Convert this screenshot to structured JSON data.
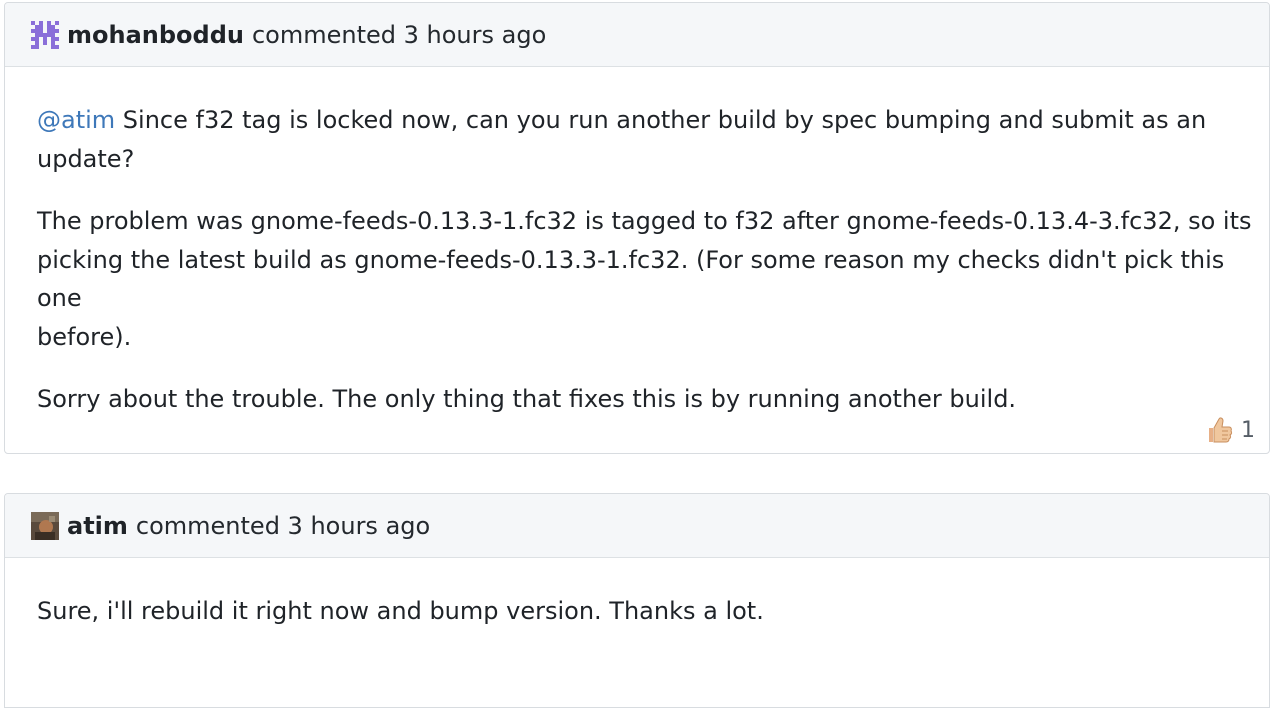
{
  "comments": [
    {
      "author": "mohanboddu",
      "meta": "commented 3 hours ago",
      "mention": "@atim",
      "paragraphs": [
        " Since f32 tag is locked now, can you run another build by spec bumping and submit as an\nupdate?",
        "The problem was gnome-feeds-0.13.3-1.fc32 is tagged to f32 after gnome-feeds-0.13.4-3.fc32, so its\npicking the latest build as gnome-feeds-0.13.3-1.fc32. (For some reason my checks didn't pick this one\nbefore).",
        "Sorry about the trouble. The only thing that fixes this is by running another build."
      ],
      "reaction": {
        "icon": "thumbs-up-icon",
        "count": "1"
      }
    },
    {
      "author": "atim",
      "meta": "commented 3 hours ago",
      "paragraphs": [
        "Sure, i'll rebuild it right now and bump version. Thanks a lot."
      ]
    }
  ],
  "colors": {
    "mention": "#3e78b9",
    "header_bg": "#f5f7f9",
    "border": "#d8dce0",
    "identicon": "#8a6fd9"
  }
}
